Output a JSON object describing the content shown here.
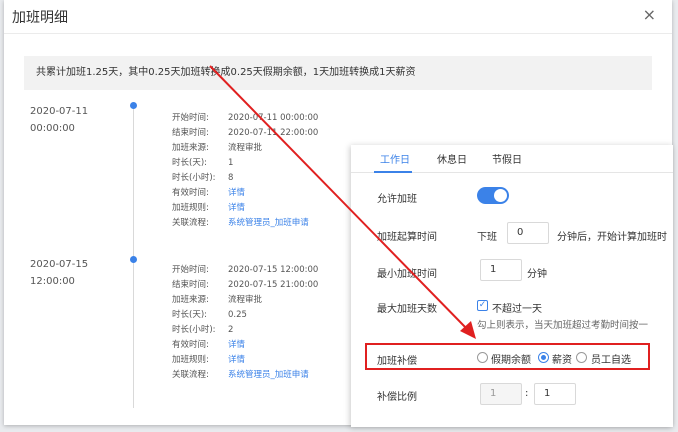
{
  "dialog": {
    "title": "加班明细",
    "close_icon": "close-icon"
  },
  "summary": "共累计加班1.25天，其中0.25天加班转换成0.25天假期余额，1天加班转换成1天薪资",
  "records": [
    {
      "date": "2020-07-11",
      "time": "00:00:00",
      "fields": [
        {
          "label": "开始时间:",
          "value": "2020-07-11 00:00:00",
          "link": false
        },
        {
          "label": "结束时间:",
          "value": "2020-07-11 22:00:00",
          "link": false
        },
        {
          "label": "加班来源:",
          "value": "流程审批",
          "link": false
        },
        {
          "label": "时长(天):",
          "value": "1",
          "link": false
        },
        {
          "label": "时长(小时):",
          "value": "8",
          "link": false
        },
        {
          "label": "有效时间:",
          "value": "详情",
          "link": true
        },
        {
          "label": "加班规则:",
          "value": "详情",
          "link": true
        },
        {
          "label": "关联流程:",
          "value": "系统管理员_加班申请",
          "link": true
        }
      ]
    },
    {
      "date": "2020-07-15",
      "time": "12:00:00",
      "fields": [
        {
          "label": "开始时间:",
          "value": "2020-07-15 12:00:00",
          "link": false
        },
        {
          "label": "结束时间:",
          "value": "2020-07-15 21:00:00",
          "link": false
        },
        {
          "label": "加班来源:",
          "value": "流程审批",
          "link": false
        },
        {
          "label": "时长(天):",
          "value": "0.25",
          "link": false
        },
        {
          "label": "时长(小时):",
          "value": "2",
          "link": false
        },
        {
          "label": "有效时间:",
          "value": "详情",
          "link": true
        },
        {
          "label": "加班规则:",
          "value": "详情",
          "link": true
        },
        {
          "label": "关联流程:",
          "value": "系统管理员_加班申请",
          "link": true
        }
      ]
    }
  ],
  "panel": {
    "tabs": [
      "工作日",
      "休息日",
      "节假日"
    ],
    "allow_label": "允许加班",
    "allow_on": true,
    "start_label": "加班起算时间",
    "start_prefix": "下班",
    "start_value": "0",
    "start_suffix": "分钟后，开始计算加班时",
    "min_label": "最小加班时间",
    "min_value": "1",
    "min_unit": "分钟",
    "max_label": "最大加班天数",
    "max_option": "不超过一天",
    "max_checked": true,
    "max_hint": "勾上则表示，当天加班超过考勤时间按一",
    "comp_label": "加班补偿",
    "comp_options": [
      "假期余额",
      "薪资",
      "员工自选"
    ],
    "comp_selected": 1,
    "ratio_label": "补偿比例",
    "ratio_left": "1",
    "ratio_sep": ":",
    "ratio_right": "1"
  },
  "colors": {
    "accent": "#3b82e8",
    "annotation": "#e02020"
  }
}
